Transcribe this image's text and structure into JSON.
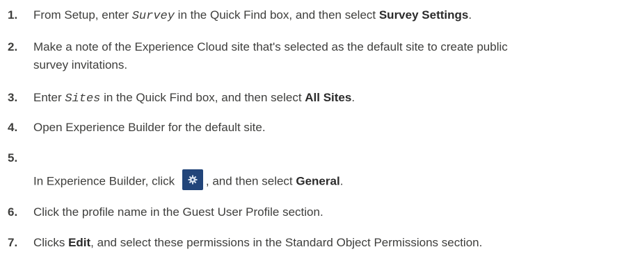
{
  "steps": [
    {
      "num": "1.",
      "t1": "From Setup, enter ",
      "code": "Survey",
      "t2": " in the Quick Find box, and then select ",
      "bold": "Survey Settings",
      "t3": "."
    },
    {
      "num": "2.",
      "line1": "Make a note of the Experience Cloud site that's selected as the default site to create public",
      "line2": "survey invitations."
    },
    {
      "num": "3.",
      "t1": "Enter ",
      "code": "Sites",
      "t2": " in the Quick Find box, and then select ",
      "bold": "All Sites",
      "t3": "."
    },
    {
      "num": "4.",
      "text": "Open Experience Builder for the default site."
    },
    {
      "num": "5.",
      "t1": "In Experience Builder, click ",
      "icon": "gear-icon",
      "t2": ", and then select ",
      "bold": "General",
      "t3": "."
    },
    {
      "num": "6.",
      "text": "Click the profile name in the Guest User Profile section."
    },
    {
      "num": "7.",
      "t1": "Clicks ",
      "bold": "Edit",
      "t2": ", and select these permissions in the Standard Object Permissions section."
    }
  ],
  "colors": {
    "text": "#3e3e3c",
    "gear_button_bg": "#22457a"
  }
}
